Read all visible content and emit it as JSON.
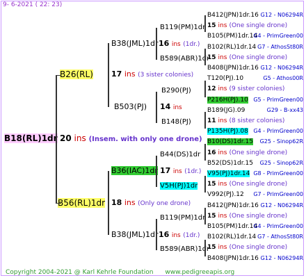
{
  "header": {
    "date": "9-  6-2021 ( 22: 23)"
  },
  "footer": {
    "copyright": "Copyright 2004-2021 @ Karl Kehrle Foundation",
    "site": "www.pedigreeapis.org"
  },
  "root": {
    "name": "B18(RL)1dr",
    "ins": "20",
    "ins_label": "ins",
    "note": "(Insem. with only one drone)"
  },
  "gen1": [
    {
      "name": "B26(RL)",
      "ins": "17",
      "ins_label": "ins",
      "note": "(3 sister colonies)"
    },
    {
      "name": "B56(RL)1dr",
      "ins": "18",
      "ins_label": "ins",
      "note": "(Only one drone)"
    }
  ],
  "gen2": [
    {
      "name": "B38(JML)1dr",
      "ins": "16",
      "ins_label": "ins",
      "note": "(1dr.)"
    },
    {
      "name": "B503(PJ)",
      "ins": "14",
      "ins_label": "ins",
      "note": ""
    },
    {
      "name": "B36(IAC)1dr",
      "ins": "17",
      "ins_label": "ins",
      "note": "(1dr.)"
    },
    {
      "name": "B38(JML)1dr",
      "ins": "16",
      "ins_label": "ins",
      "note": "(1dr.)"
    }
  ],
  "gen3": [
    {
      "name": "B119(PM)1dr",
      "ins": "",
      "ins_label": "",
      "note": ""
    },
    {
      "name": "B589(ABR)1dr",
      "ins": "",
      "ins_label": "",
      "note": ""
    },
    {
      "name": "B290(PJ)",
      "ins": "",
      "ins_label": "",
      "note": ""
    },
    {
      "name": "B148(PJ)",
      "ins": "",
      "ins_label": "",
      "note": ""
    },
    {
      "name": "B44(DS)1dr",
      "ins": "",
      "ins_label": "",
      "note": ""
    },
    {
      "name": "V5H(PJ)1dr",
      "ins": "",
      "ins_label": "",
      "note": ""
    },
    {
      "name": "B119(PM)1dr",
      "ins": "16",
      "ins_label": "ins",
      "note": "(1dr.)"
    },
    {
      "name": "B589(ABR)1dr",
      "ins": "",
      "ins_label": "",
      "note": ""
    }
  ],
  "gen4": [
    {
      "name": "B412(JPN)1dr.16",
      "ins": "",
      "note": "",
      "right": "G12 - N06294R"
    },
    {
      "name": "15",
      "ins": "ins",
      "note": "(One single drone)",
      "right": ""
    },
    {
      "name": "B105(PM)1dr.14",
      "ins": "",
      "note": "",
      "right": "G4 - PrimGreen00"
    },
    {
      "name": "B102(RL)1dr.14",
      "ins": "",
      "note": "",
      "right": "G7 - AthosSt80R"
    },
    {
      "name": "15",
      "ins": "ins",
      "note": "(One single drone)",
      "right": ""
    },
    {
      "name": "B408(JPN)1dr.16",
      "ins": "",
      "note": "",
      "right": "G12 - N06294R"
    },
    {
      "name": "T120(PJ).10",
      "ins": "",
      "note": "",
      "right": "G5 - Athos00R"
    },
    {
      "name": "12",
      "ins": "ins",
      "note": "(9 sister colonies)",
      "right": ""
    },
    {
      "name": "P216H(PJ).10",
      "ins": "",
      "note": "",
      "right": "G5 - PrimGreen00"
    },
    {
      "name": "B189(JG).09",
      "ins": "",
      "note": "",
      "right": "G29 - B-xx43"
    },
    {
      "name": "11",
      "ins": "ins",
      "note": "(8 sister colonies)",
      "right": ""
    },
    {
      "name": "P135H(PJ).08",
      "ins": "",
      "note": "",
      "right": "G4 - PrimGreen00"
    },
    {
      "name": "B10(DS)1dr.15",
      "ins": "",
      "note": "",
      "right": "G25 - Sinop62R"
    },
    {
      "name": "16",
      "ins": "ins",
      "note": "(One single drone)",
      "right": ""
    },
    {
      "name": "B52(DS)1dr.15",
      "ins": "",
      "note": "",
      "right": "G25 - Sinop62R"
    },
    {
      "name": "V95(PJ)1dr.14",
      "ins": "",
      "note": "",
      "right": "G8 - PrimGreen00"
    },
    {
      "name": "15",
      "ins": "ins",
      "note": "(One single drone)",
      "right": ""
    },
    {
      "name": "V992(PJ).12",
      "ins": "",
      "note": "",
      "right": "G7 - PrimGreen00"
    },
    {
      "name": "B412(JPN)1dr.16",
      "ins": "",
      "note": "",
      "right": "G12 - N06294R"
    },
    {
      "name": "15",
      "ins": "ins",
      "note": "(One single drone)",
      "right": ""
    },
    {
      "name": "B105(PM)1dr.14",
      "ins": "",
      "note": "",
      "right": "G4 - PrimGreen00"
    },
    {
      "name": "B102(RL)1dr.14",
      "ins": "",
      "note": "",
      "right": "G7 - AthosSt80R"
    },
    {
      "name": "15",
      "ins": "ins",
      "note": "(One single drone)",
      "right": ""
    },
    {
      "name": "B408(JPN)1dr.16",
      "ins": "",
      "note": "",
      "right": "G12 - N06294R"
    }
  ]
}
